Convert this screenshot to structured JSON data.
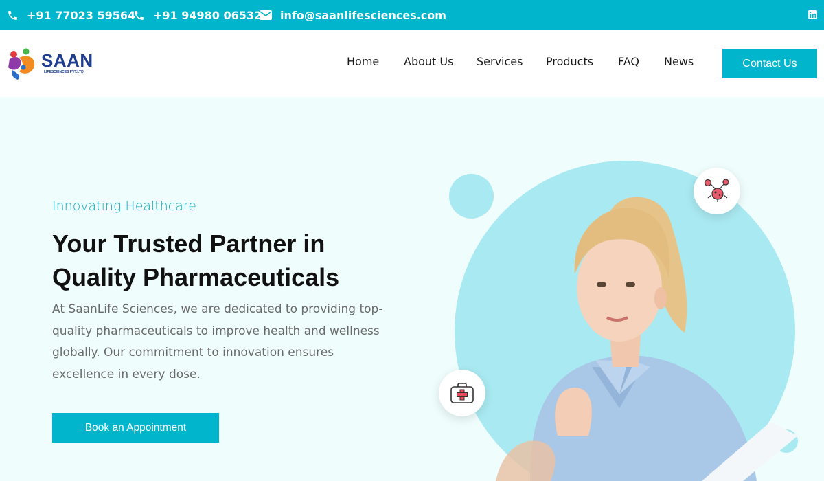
{
  "topbar": {
    "phone1": "+91 77023 59564",
    "phone2": "+91 94980 06532",
    "email": "info@saanlifesciences.com",
    "social_icon": "linkedin-icon"
  },
  "header": {
    "logo_text": "SAAN",
    "logo_sub": "LIFESCIENCES PVT.LTD",
    "nav": [
      "Home",
      "About Us",
      "Services",
      "Products",
      "FAQ",
      "News"
    ],
    "contact_label": "Contact Us"
  },
  "hero": {
    "tagline": "Innovating Healthcare",
    "headline": "Your Trusted Partner in Quality Pharmaceuticals",
    "description": "At SaanLife Sciences, we are dedicated to providing top-quality pharmaceuticals to improve health and wellness globally. Our commitment to innovation ensures excellence in every dose.",
    "button_label": "Book an Appointment",
    "badges": [
      "virus-icon",
      "first-aid-kit-icon"
    ]
  },
  "colors": {
    "accent": "#00b5cc",
    "hero_bg": "#effdfd",
    "circle": "#a9e9f1",
    "brand_blue": "#1f3e8f"
  }
}
